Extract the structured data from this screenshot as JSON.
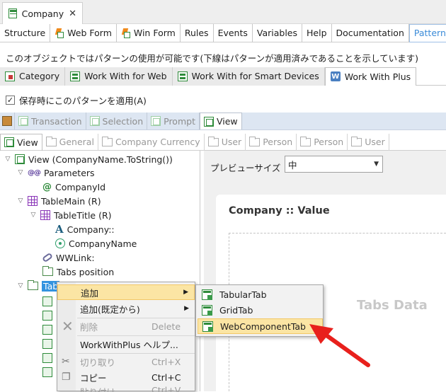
{
  "doc_tab": {
    "title": "Company",
    "close": "✕"
  },
  "part_tabs": [
    "Structure",
    "Web Form",
    "Win Form",
    "Rules",
    "Events",
    "Variables",
    "Help",
    "Documentation",
    "Patterns"
  ],
  "note": "このオブジェクトではパターンの使用が可能です(下線はパターンが適用済みであることを示しています)",
  "pattern_tabs": [
    "Category",
    "Work With for Web",
    "Work With for Smart Devices",
    "Work With Plus"
  ],
  "apply_checkbox": {
    "label": "保存時にこのパターンを適用(A)",
    "checked": true
  },
  "instance_tabs": [
    "Transaction",
    "Selection",
    "Prompt",
    "View"
  ],
  "sub_tabs": [
    "View",
    "General",
    "Company Currency",
    "User",
    "Person",
    "Person",
    "User"
  ],
  "tree": {
    "root": "View (CompanyName.ToString())",
    "parameters": "Parameters",
    "param_prefix": "@@",
    "company_id": "CompanyId",
    "table_main": "TableMain (R)",
    "table_title": "TableTitle (R)",
    "company_label": "Company::",
    "company_name": "CompanyName",
    "wwlink": "WWLink:",
    "tabs_position": "Tabs position",
    "tabs_selected": "Tab"
  },
  "preview": {
    "size_label": "プレビューサイズ",
    "size_value": "中",
    "title": "Company :: Value",
    "tabs_data": "Tabs Data"
  },
  "context_menu": {
    "add": "追加",
    "add_default": "追加(既定から)",
    "delete": "削除",
    "delete_shortcut": "Delete",
    "wwp_help": "WorkWithPlus ヘルプ...",
    "cut": "切り取り",
    "cut_shortcut": "Ctrl+X",
    "copy": "コピー",
    "copy_shortcut": "Ctrl+C",
    "paste": "貼り付け",
    "paste_shortcut": "Ctrl+V"
  },
  "submenu": [
    "TabularTab",
    "GridTab",
    "WebComponentTab"
  ],
  "colors": {
    "accent_blue": "#3393df",
    "highlight": "#fbe5a4",
    "arrow_red": "#e8201c",
    "patterns_tab": "#3b8bd8"
  }
}
